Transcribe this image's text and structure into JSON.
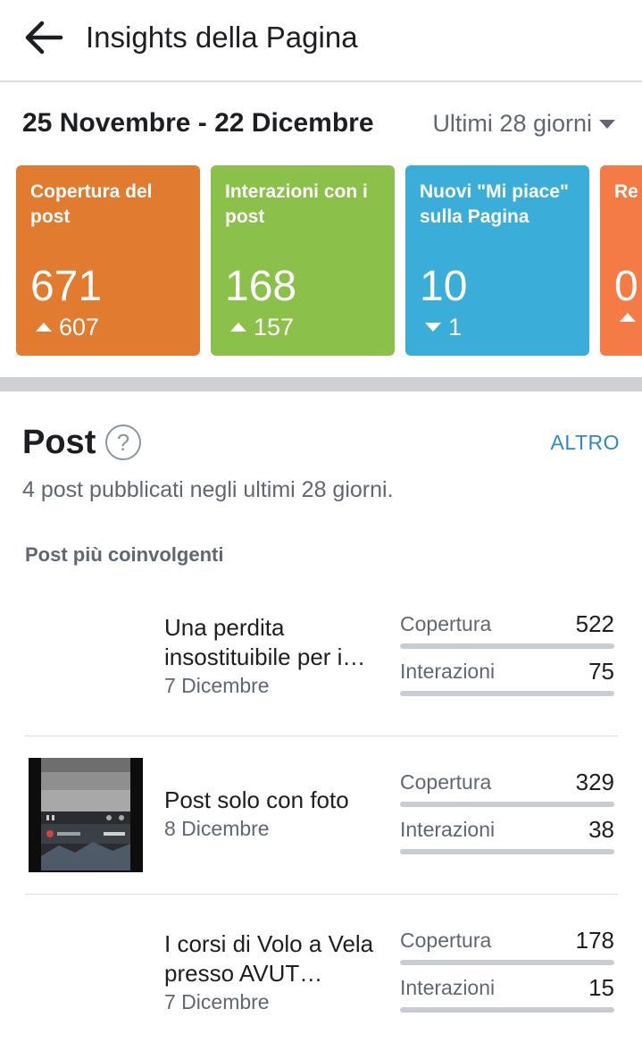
{
  "header": {
    "title": "Insights della Pagina",
    "back_icon": "arrow-left-icon"
  },
  "date_range": "25 Novembre - 22 Dicembre",
  "period": {
    "label": "Ultimi 28 giorni",
    "icon": "caret-down-icon"
  },
  "cards": [
    {
      "title": "Copertura del post",
      "value": "671",
      "change": "607",
      "direction": "up",
      "color": "#e07b2f"
    },
    {
      "title": "Interazioni con i post",
      "value": "168",
      "change": "157",
      "direction": "up",
      "color": "#8bc04a"
    },
    {
      "title": "Nuovi \"Mi piace\" sulla Pagina",
      "value": "10",
      "change": "1",
      "direction": "down",
      "color": "#3aaed8"
    },
    {
      "title": "Re",
      "value": "0",
      "change": "",
      "direction": "up",
      "color": "#f47b45"
    }
  ],
  "posts_section": {
    "title": "Post",
    "help_icon": "question-circle-icon",
    "more_link": "ALTRO",
    "summary": "4 post pubblicati negli ultimi 28 giorni.",
    "subheading": "Post più coinvolgenti"
  },
  "posts": [
    {
      "title": "Una perdita insostituibile per i…",
      "date": "7 Dicembre",
      "reach_label": "Copertura",
      "reach": "522",
      "reach_fill": 1.0,
      "interactions_label": "Interazioni",
      "interactions": "75",
      "interactions_fill": 1.0,
      "has_thumbnail": false
    },
    {
      "title": "Post solo con foto",
      "date": "8 Dicembre",
      "reach_label": "Copertura",
      "reach": "329",
      "reach_fill": 1.0,
      "interactions_label": "Interazioni",
      "interactions": "38",
      "interactions_fill": 1.0,
      "has_thumbnail": true
    },
    {
      "title": "I corsi di Volo a Vela presso AVUT…",
      "date": "7 Dicembre",
      "reach_label": "Copertura",
      "reach": "178",
      "reach_fill": 1.0,
      "interactions_label": "Interazioni",
      "interactions": "15",
      "interactions_fill": 1.0,
      "has_thumbnail": false
    }
  ],
  "colors": {
    "link": "#2d88ce",
    "secondary_text": "#606770",
    "band": "#ced0d4"
  }
}
